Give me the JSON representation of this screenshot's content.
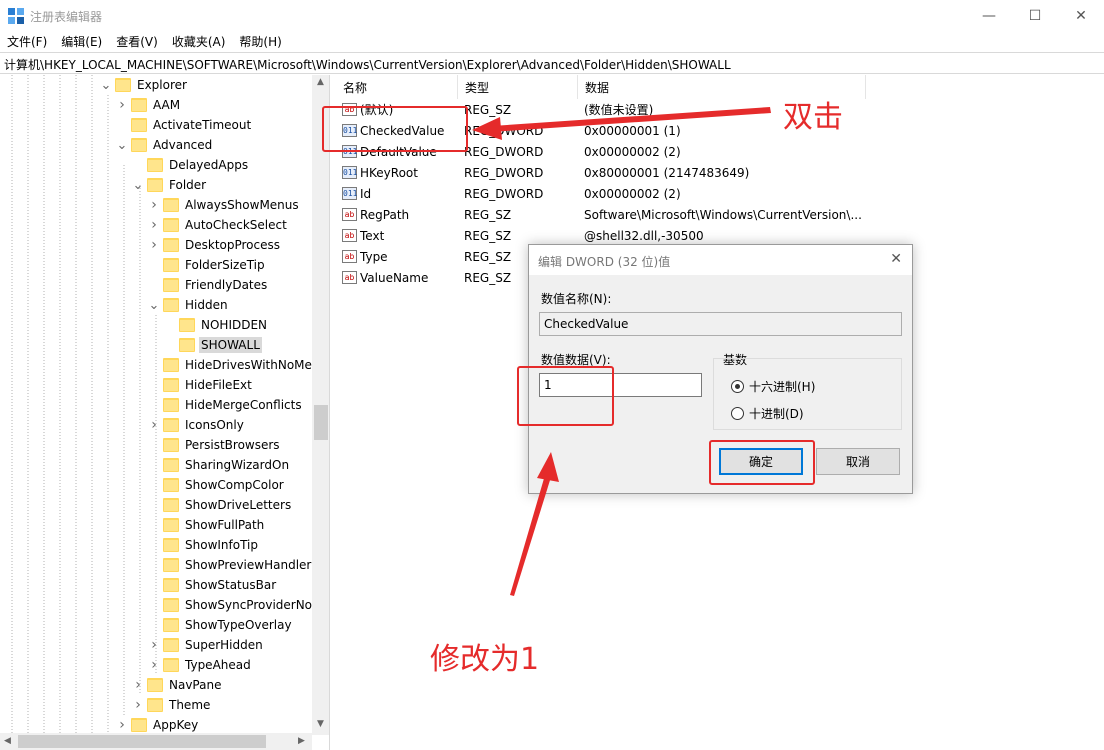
{
  "window": {
    "title": "注册表编辑器",
    "minimize_glyph": "—",
    "maximize_glyph": "☐",
    "close_glyph": "✕"
  },
  "menu": [
    "文件(F)",
    "编辑(E)",
    "查看(V)",
    "收藏夹(A)",
    "帮助(H)"
  ],
  "address": "计算机\\HKEY_LOCAL_MACHINE\\SOFTWARE\\Microsoft\\Windows\\CurrentVersion\\Explorer\\Advanced\\Folder\\Hidden\\SHOWALL",
  "tree": {
    "items": [
      {
        "label": "Explorer",
        "depth": 0,
        "expander": "open"
      },
      {
        "label": "AAM",
        "depth": 1,
        "expander": "closed"
      },
      {
        "label": "ActivateTimeout",
        "depth": 1,
        "expander": "none"
      },
      {
        "label": "Advanced",
        "depth": 1,
        "expander": "open"
      },
      {
        "label": "DelayedApps",
        "depth": 2,
        "expander": "none"
      },
      {
        "label": "Folder",
        "depth": 2,
        "expander": "open"
      },
      {
        "label": "AlwaysShowMenus",
        "depth": 3,
        "expander": "closed"
      },
      {
        "label": "AutoCheckSelect",
        "depth": 3,
        "expander": "closed"
      },
      {
        "label": "DesktopProcess",
        "depth": 3,
        "expander": "closed"
      },
      {
        "label": "FolderSizeTip",
        "depth": 3,
        "expander": "none"
      },
      {
        "label": "FriendlyDates",
        "depth": 3,
        "expander": "none"
      },
      {
        "label": "Hidden",
        "depth": 3,
        "expander": "open"
      },
      {
        "label": "NOHIDDEN",
        "depth": 4,
        "expander": "none"
      },
      {
        "label": "SHOWALL",
        "depth": 4,
        "expander": "none",
        "selected": true
      },
      {
        "label": "HideDrivesWithNoMe",
        "depth": 3,
        "expander": "none"
      },
      {
        "label": "HideFileExt",
        "depth": 3,
        "expander": "none"
      },
      {
        "label": "HideMergeConflicts",
        "depth": 3,
        "expander": "none"
      },
      {
        "label": "IconsOnly",
        "depth": 3,
        "expander": "closed"
      },
      {
        "label": "PersistBrowsers",
        "depth": 3,
        "expander": "none"
      },
      {
        "label": "SharingWizardOn",
        "depth": 3,
        "expander": "none"
      },
      {
        "label": "ShowCompColor",
        "depth": 3,
        "expander": "none"
      },
      {
        "label": "ShowDriveLetters",
        "depth": 3,
        "expander": "none"
      },
      {
        "label": "ShowFullPath",
        "depth": 3,
        "expander": "none"
      },
      {
        "label": "ShowInfoTip",
        "depth": 3,
        "expander": "none"
      },
      {
        "label": "ShowPreviewHandlers",
        "depth": 3,
        "expander": "none"
      },
      {
        "label": "ShowStatusBar",
        "depth": 3,
        "expander": "none"
      },
      {
        "label": "ShowSyncProviderNot",
        "depth": 3,
        "expander": "none"
      },
      {
        "label": "ShowTypeOverlay",
        "depth": 3,
        "expander": "none"
      },
      {
        "label": "SuperHidden",
        "depth": 3,
        "expander": "closed"
      },
      {
        "label": "TypeAhead",
        "depth": 3,
        "expander": "closed"
      },
      {
        "label": "NavPane",
        "depth": 2,
        "expander": "closed"
      },
      {
        "label": "Theme",
        "depth": 2,
        "expander": "closed"
      },
      {
        "label": "AppKey",
        "depth": 1,
        "expander": "closed"
      }
    ]
  },
  "list": {
    "columns": [
      "名称",
      "类型",
      "数据"
    ],
    "rows": [
      {
        "name": "(默认)",
        "type": "REG_SZ",
        "data": "(数值未设置)",
        "icon": "sz"
      },
      {
        "name": "CheckedValue",
        "type": "REG_DWORD",
        "data": "0x00000001 (1)",
        "icon": "dw"
      },
      {
        "name": "DefaultValue",
        "type": "REG_DWORD",
        "data": "0x00000002 (2)",
        "icon": "dw"
      },
      {
        "name": "HKeyRoot",
        "type": "REG_DWORD",
        "data": "0x80000001 (2147483649)",
        "icon": "dw"
      },
      {
        "name": "Id",
        "type": "REG_DWORD",
        "data": "0x00000002 (2)",
        "icon": "dw"
      },
      {
        "name": "RegPath",
        "type": "REG_SZ",
        "data": "Software\\Microsoft\\Windows\\CurrentVersion\\...",
        "icon": "sz"
      },
      {
        "name": "Text",
        "type": "REG_SZ",
        "data": "@shell32.dll,-30500",
        "icon": "sz"
      },
      {
        "name": "Type",
        "type": "REG_SZ",
        "data": "",
        "icon": "sz"
      },
      {
        "name": "ValueName",
        "type": "REG_SZ",
        "data": "",
        "icon": "sz"
      }
    ]
  },
  "dialog": {
    "title": "编辑 DWORD (32 位)值",
    "name_label": "数值名称(N):",
    "name_value": "CheckedValue",
    "data_label": "数值数据(V):",
    "data_value": "1",
    "base_label": "基数",
    "hex_label": "十六进制(H)",
    "dec_label": "十进制(D)",
    "hex_selected": true,
    "ok_label": "确定",
    "cancel_label": "取消",
    "close_glyph": "✕"
  },
  "annotations": {
    "double_click": "双击",
    "change_to_1": "修改为1",
    "color": "#e52b2b"
  }
}
